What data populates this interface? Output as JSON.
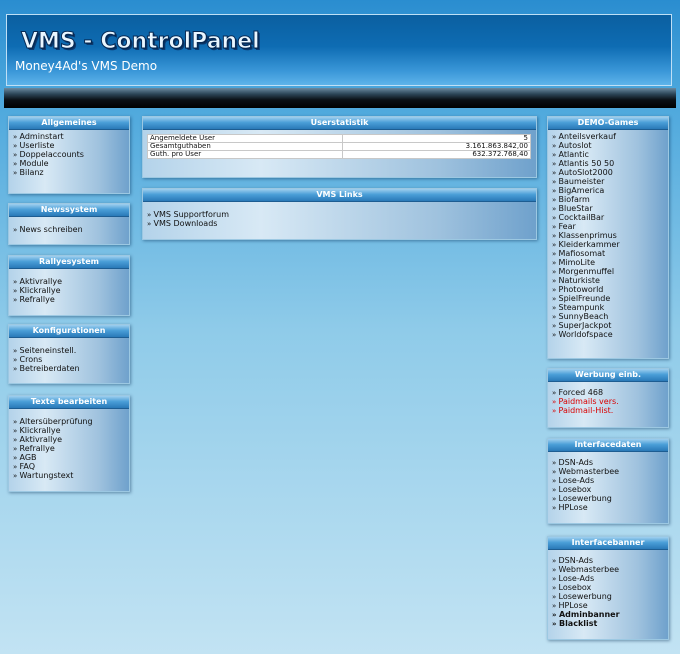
{
  "header": {
    "logo_text": "VMS - ControlPanel",
    "subtitle": "Money4Ad's VMS Demo"
  },
  "left": {
    "allgemeines": {
      "title": "Allgemeines",
      "items": [
        "Adminstart",
        "Userliste",
        "Doppelaccounts",
        "Module",
        "Bilanz"
      ]
    },
    "newssystem": {
      "title": "Newssystem",
      "items": [
        "News schreiben"
      ]
    },
    "rallyesystem": {
      "title": "Rallyesystem",
      "items": [
        "Aktivrallye",
        "Klickrallye",
        "Refrallye"
      ]
    },
    "konfigurationen": {
      "title": "Konfigurationen",
      "items": [
        "Seiteneinstell.",
        "Crons",
        "Betreiberdaten"
      ]
    },
    "texte": {
      "title": "Texte bearbeiten",
      "items": [
        "Altersüberprüfung",
        "Klickrallye",
        "Aktivrallye",
        "Refrallye",
        "AGB",
        "FAQ",
        "Wartungstext"
      ]
    }
  },
  "center": {
    "userstatistik": {
      "title": "Userstatistik",
      "rows": [
        {
          "label": "Angemeldete User",
          "value": "5"
        },
        {
          "label": "Gesamtguthaben",
          "value": "3.161.863.842,00"
        },
        {
          "label": "Guth. pro User",
          "value": "632.372.768,40"
        }
      ]
    },
    "vmslinks": {
      "title": "VMS Links",
      "items": [
        "VMS Supportforum",
        "VMS Downloads"
      ]
    }
  },
  "right": {
    "demogames": {
      "title": "DEMO-Games",
      "items": [
        "Anteilsverkauf",
        "Autoslot",
        "Atlantic",
        "Atlantis 50 50",
        "AutoSlot2000",
        "Baumeister",
        "BigAmerica",
        "Biofarm",
        "BlueStar",
        "CocktailBar",
        "Fear",
        "Klassenprimus",
        "Kleiderkammer",
        "Mafiosomat",
        "MimoLite",
        "Morgenmuffel",
        "Naturkiste",
        "Photoworld",
        "SpielFreunde",
        "Steampunk",
        "SunnyBeach",
        "SuperJackpot",
        "Worldofspace"
      ]
    },
    "werbung": {
      "title": "Werbung einb.",
      "items": [
        {
          "label": "Forced 468",
          "style": ""
        },
        {
          "label": "Paidmails vers.",
          "style": "red"
        },
        {
          "label": "Paidmail-Hist.",
          "style": "red"
        }
      ]
    },
    "interfacedaten": {
      "title": "Interfacedaten",
      "items": [
        "DSN-Ads",
        "Webmasterbee",
        "Lose-Ads",
        "Losebox",
        "Losewerbung",
        "HPLose"
      ]
    },
    "interfacebanner": {
      "title": "Interfacebanner",
      "items": [
        {
          "label": "DSN-Ads",
          "style": ""
        },
        {
          "label": "Webmasterbee",
          "style": ""
        },
        {
          "label": "Lose-Ads",
          "style": ""
        },
        {
          "label": "Losebox",
          "style": ""
        },
        {
          "label": "Losewerbung",
          "style": ""
        },
        {
          "label": "HPLose",
          "style": ""
        },
        {
          "label": "Adminbanner",
          "style": "bold"
        },
        {
          "label": "Blacklist",
          "style": "bold"
        }
      ]
    }
  }
}
